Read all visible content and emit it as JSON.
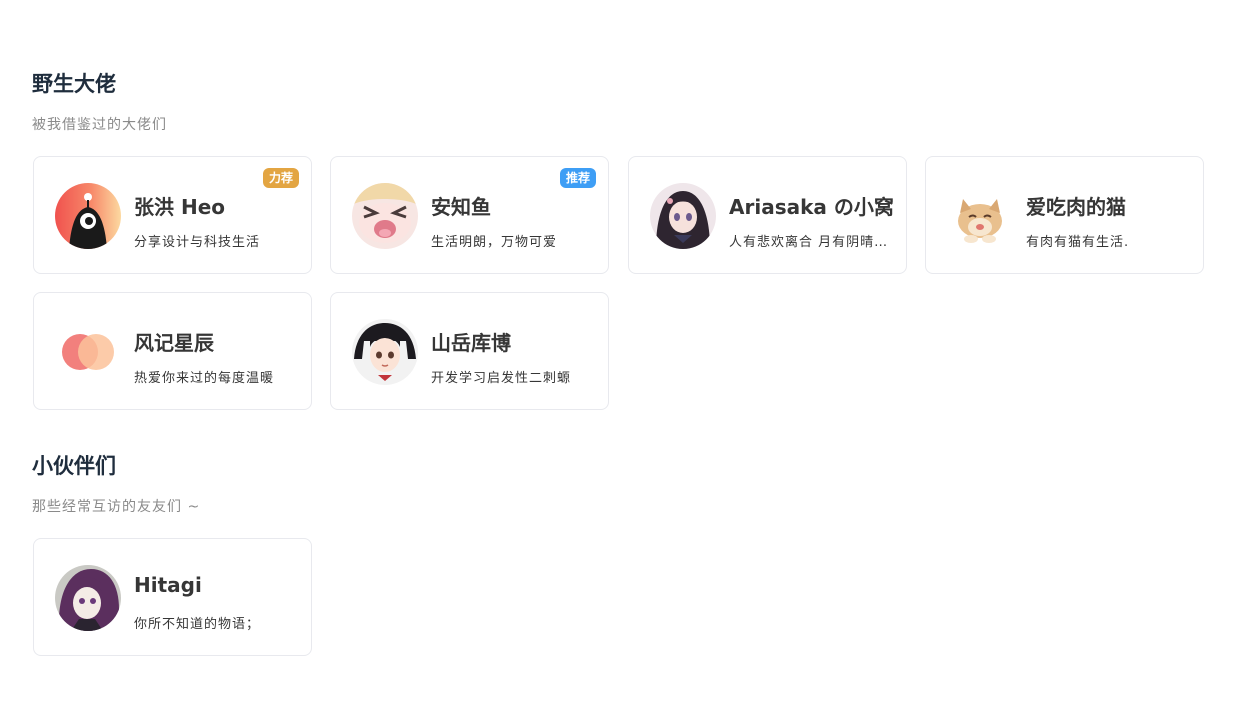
{
  "sections": [
    {
      "title": "野生大佬",
      "description": "被我借鉴过的大佬们",
      "cards": [
        {
          "name": "张洪 Heo",
          "description": "分享设计与科技生活",
          "tag": "力荐",
          "tag_color": "#e3a542",
          "avatar_icon": "heo-monster-avatar"
        },
        {
          "name": "安知鱼",
          "description": "生活明朗，万物可爱",
          "tag": "推荐",
          "tag_color": "#3e9ef5",
          "avatar_icon": "anzhiyu-anime-avatar"
        },
        {
          "name": "Ariasaka の小窝",
          "description": "人有悲欢离合 月有阴晴圆缺",
          "avatar_icon": "ariasaka-anime-girl-avatar"
        },
        {
          "name": "爱吃肉的猫",
          "description": "有肉有猫有生活.",
          "avatar_icon": "cat-avatar"
        },
        {
          "name": "风记星辰",
          "description": "热爱你来过的每度温暖",
          "avatar_icon": "overlapping-circles-logo"
        },
        {
          "name": "山岳库博",
          "description": "开发学习启发性二刺螈",
          "avatar_icon": "azusa-anime-avatar"
        }
      ]
    },
    {
      "title": "小伙伴们",
      "description": "那些经常互访的友友们 ~",
      "cards": [
        {
          "name": "Hitagi",
          "description": "你所不知道的物语；",
          "avatar_icon": "hitagi-anime-avatar"
        }
      ]
    }
  ]
}
